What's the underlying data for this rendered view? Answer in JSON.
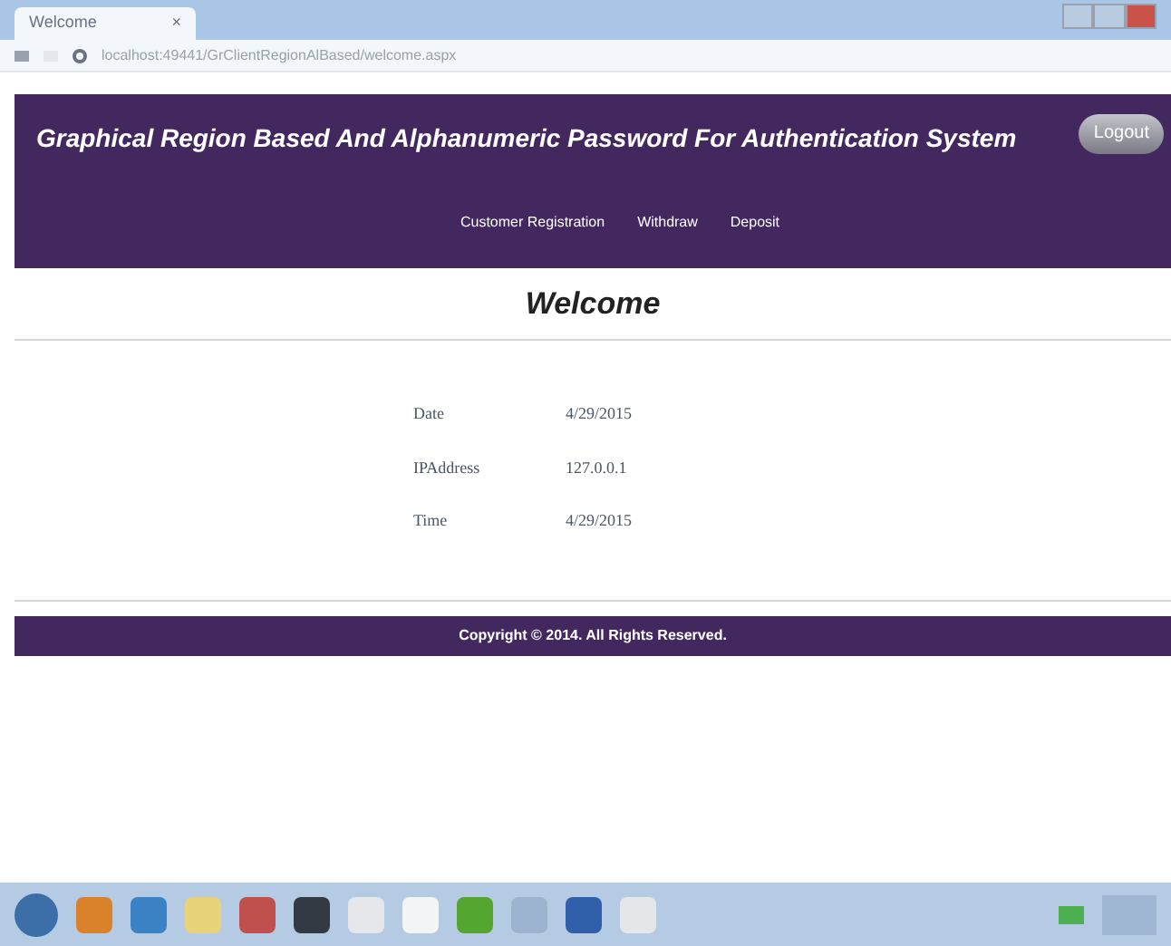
{
  "browser": {
    "tab_title": "Welcome",
    "tab_close": "×",
    "url": "localhost:49441/GrClientRegionAlBased/welcome.aspx"
  },
  "header": {
    "title": "Graphical Region Based And Alphanumeric Password For Authentication System",
    "logout": "Logout",
    "nav": [
      "Customer Registration",
      "Withdraw",
      "Deposit"
    ]
  },
  "heading": "Welcome",
  "details": [
    {
      "label": "Date",
      "value": "4/29/2015"
    },
    {
      "label": "IPAddress",
      "value": "127.0.0.1"
    },
    {
      "label": "Time",
      "value": "4/29/2015"
    }
  ],
  "footer": "Copyright © 2014. All Rights Reserved."
}
